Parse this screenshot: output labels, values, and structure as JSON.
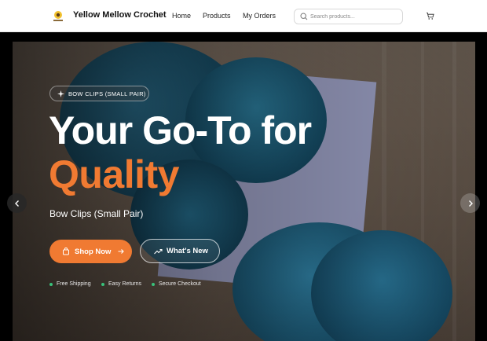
{
  "header": {
    "brand": "Yellow Mellow Crochet",
    "logo_icon": "crochet-logo",
    "nav": [
      {
        "label": "Home"
      },
      {
        "label": "Products"
      },
      {
        "label": "My Orders"
      }
    ],
    "search": {
      "placeholder": "Search products...",
      "value": ""
    },
    "cart_icon": "cart-icon"
  },
  "hero": {
    "badge": "BOW CLIPS (SMALL PAIR)",
    "title_line1": "Your Go-To for",
    "title_line2": "Quality",
    "subtitle": "Bow Clips (Small Pair)",
    "primary_button": "Shop Now",
    "secondary_button": "What's New",
    "features": [
      "Free Shipping",
      "Easy Returns",
      "Secure Checkout"
    ],
    "colors": {
      "accent": "#f07a32",
      "feature_dot": "#39c27a",
      "yarn": "#1f5b78"
    }
  }
}
